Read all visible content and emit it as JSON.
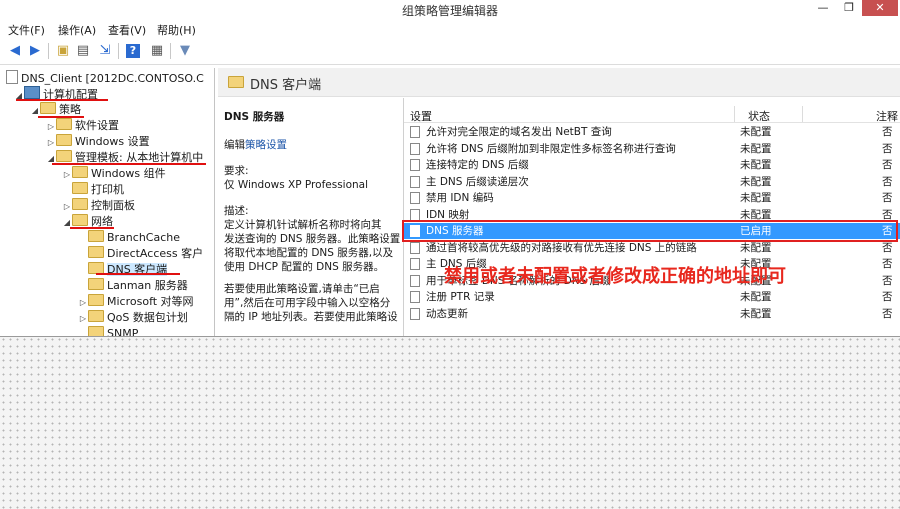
{
  "window": {
    "title": "组策略管理编辑器",
    "controls": {
      "minimize": "—",
      "maximize": "❐",
      "close": "✕"
    }
  },
  "menu": [
    "文件(F)",
    "操作(A)",
    "查看(V)",
    "帮助(H)"
  ],
  "toolbar": {
    "icons": [
      "back-arrow-icon",
      "forward-arrow-icon",
      "up-folder-icon",
      "show-tree-icon",
      "export-icon",
      "help-icon",
      "properties-icon",
      "filter-icon"
    ]
  },
  "tree": {
    "root": "DNS_Client [2012DC.CONTOSO.C",
    "computer_config": "计算机配置",
    "policies": "策略",
    "software_settings": "软件设置",
    "windows_settings": "Windows 设置",
    "admin_templates": "管理模板: 从本地计算机中",
    "windows_components": "Windows 组件",
    "printers": "打印机",
    "control_panel": "控制面板",
    "network": "网络",
    "branchcache": "BranchCache",
    "directaccess": "DirectAccess 客户",
    "dns_client": "DNS 客户端",
    "lanman": "Lanman 服务器",
    "microsoft_peer": "Microsoft 对等网",
    "qos": "QoS 数据包计划",
    "snmp": "SNMP"
  },
  "header": {
    "title": "DNS 客户端"
  },
  "description": {
    "title": "DNS 服务器",
    "edit_prefix": "编辑",
    "edit_link": "策略设置",
    "requirements_label": "要求:",
    "requirements_value": "仅 Windows XP Professional",
    "desc_label": "描述:",
    "desc_lines": [
      "定义计算机针试解析名称时将向其",
      "发送查询的 DNS 服务器。此策略设置",
      "将取代本地配置的 DNS 服务器,以及",
      "使用 DHCP 配置的 DNS 服务器。",
      "",
      "若要使用此策略设置,请单击“已启",
      "用”,然后在可用字段中输入以空格分",
      "隔的 IP 地址列表。若要使用此策略设"
    ]
  },
  "table": {
    "columns": {
      "setting": "设置",
      "state": "状态",
      "note": "注释"
    },
    "rows": [
      {
        "setting": "允许对完全限定的域名发出 NetBT 查询",
        "state": "未配置",
        "note": "否"
      },
      {
        "setting": "允许将 DNS 后缀附加到非限定性多标签名称进行查询",
        "state": "未配置",
        "note": "否"
      },
      {
        "setting": "连接特定的 DNS 后缀",
        "state": "未配置",
        "note": "否"
      },
      {
        "setting": "主 DNS 后缀读递层次",
        "state": "未配置",
        "note": "否"
      },
      {
        "setting": "禁用 IDN 编码",
        "state": "未配置",
        "note": "否"
      },
      {
        "setting": "IDN 映射",
        "state": "未配置",
        "note": "否"
      },
      {
        "setting": "DNS 服务器",
        "state": "已启用",
        "note": "否",
        "selected": true
      },
      {
        "setting": "通过首将较高优先级的对路接收有优先连接 DNS 上的链路",
        "state": "未配置",
        "note": "否"
      },
      {
        "setting": "主 DNS 后缀",
        "state": "未配置",
        "note": "否"
      },
      {
        "setting": "用于单标签 DNS 名称解析的 DNS 后缀",
        "state": "未配置",
        "note": "否"
      },
      {
        "setting": "注册 PTR 记录",
        "state": "未配置",
        "note": "否"
      },
      {
        "setting": "动态更新",
        "state": "未配置",
        "note": "否"
      }
    ]
  },
  "annotation": {
    "text": "禁用或者未配置或者修改成正确的地址即可",
    "color": "#e8281e"
  },
  "colors": {
    "selection": "#3399ff",
    "annotation_lines": "#e01010"
  }
}
